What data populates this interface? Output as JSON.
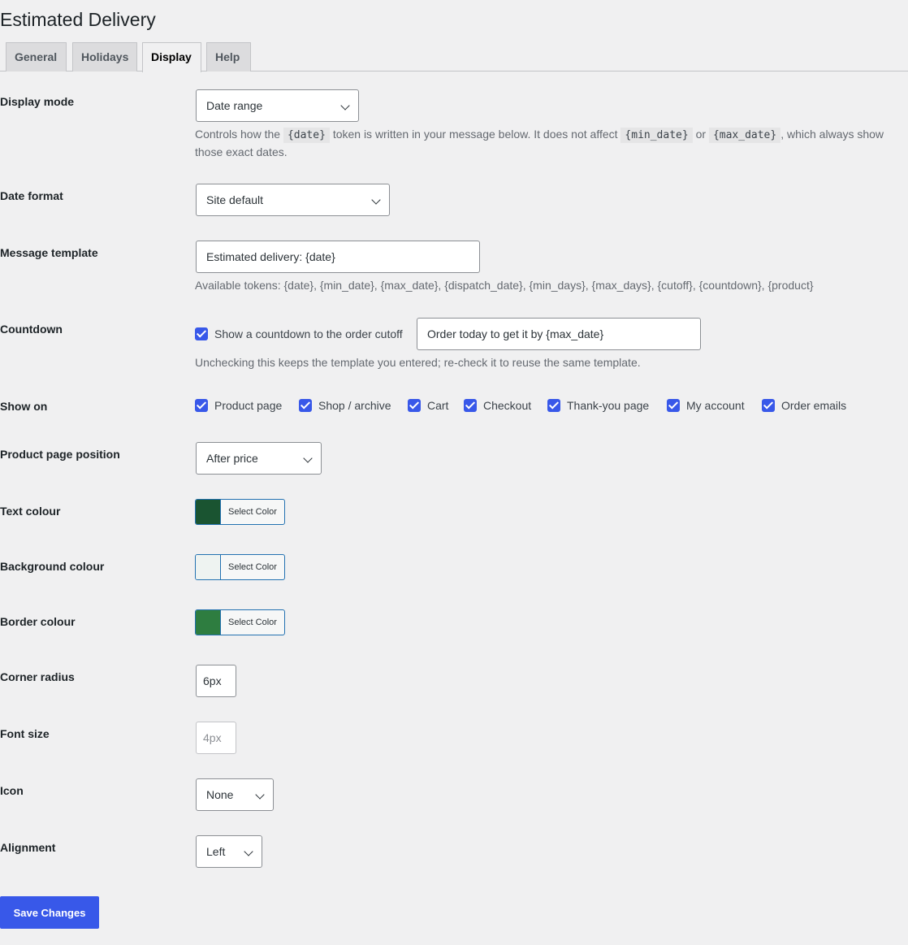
{
  "page": {
    "title": "Estimated Delivery"
  },
  "tabs": [
    {
      "label": "General"
    },
    {
      "label": "Holidays"
    },
    {
      "label": "Display"
    },
    {
      "label": "Help"
    }
  ],
  "fields": {
    "display_mode": {
      "label": "Display mode",
      "value": "Date range",
      "desc_1": "Controls how the",
      "token_date": "{date}",
      "desc_2": "token is written in your message below. It does not affect",
      "token_min": "{min_date}",
      "desc_3": "or",
      "token_max": "{max_date}",
      "desc_4": ", which always show those exact dates."
    },
    "date_format": {
      "label": "Date format",
      "value": "Site default"
    },
    "message_template": {
      "label": "Message template",
      "value": "Estimated delivery: {date}",
      "desc": "Available tokens: {date}, {min_date}, {max_date}, {dispatch_date}, {min_days}, {max_days}, {cutoff}, {countdown}, {product}"
    },
    "countdown": {
      "label": "Countdown",
      "checkbox_label": "Show a countdown to the order cutoff",
      "checked": true,
      "template_value": "Order today to get it by {max_date}",
      "desc": "Unchecking this keeps the template you entered; re-check it to reuse the same template."
    },
    "show_on": {
      "label": "Show on",
      "options": [
        {
          "label": "Product page",
          "checked": true
        },
        {
          "label": "Shop / archive",
          "checked": true
        },
        {
          "label": "Cart",
          "checked": true
        },
        {
          "label": "Checkout",
          "checked": true
        },
        {
          "label": "Thank-you page",
          "checked": true
        },
        {
          "label": "My account",
          "checked": true
        },
        {
          "label": "Order emails",
          "checked": true
        }
      ]
    },
    "product_page_position": {
      "label": "Product page position",
      "value": "After price"
    },
    "text_colour": {
      "label": "Text colour",
      "button": "Select Color",
      "color": "#1a5431"
    },
    "background_colour": {
      "label": "Background colour",
      "button": "Select Color",
      "color": "#eef3f1"
    },
    "border_colour": {
      "label": "Border colour",
      "button": "Select Color",
      "color": "#2e7d40"
    },
    "corner_radius": {
      "label": "Corner radius",
      "value": "6px"
    },
    "font_size": {
      "label": "Font size",
      "value": "4px"
    },
    "icon": {
      "label": "Icon",
      "value": "None"
    },
    "alignment": {
      "label": "Alignment",
      "value": "Left"
    }
  },
  "actions": {
    "save": "Save Changes"
  },
  "colors": {
    "accent": "#3858e9",
    "background": "#f0f0f1"
  }
}
